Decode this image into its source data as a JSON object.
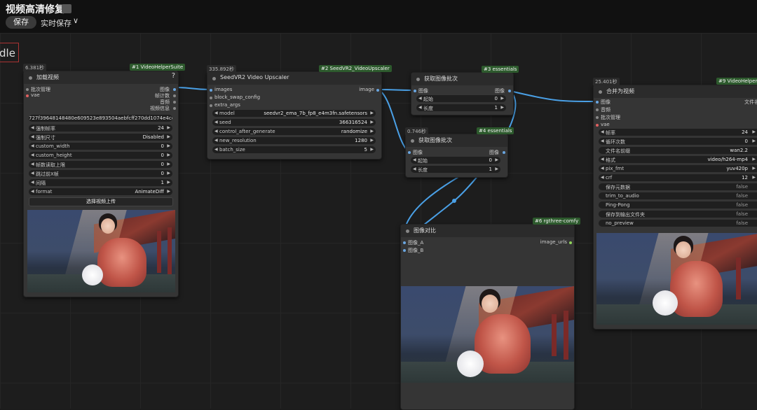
{
  "app": {
    "title": "视频高清修复",
    "save_label": "保存",
    "autosave_label": "实时保存",
    "autosave_chevron": "∨"
  },
  "group_label": "dle",
  "nodes": {
    "load_video": {
      "timer": "6.381秒",
      "badge": "#1 VideoHelperSuite",
      "title": "加载视频",
      "help": "?",
      "inputs": [
        "批次管理",
        "vae"
      ],
      "outputs": [
        "图像",
        "帧计数",
        "音频",
        "视频信息"
      ],
      "hash": "727f39648148480e609523e893504aebfcff270dd1074e4ce91a ...",
      "widgets": [
        {
          "label": "强制帧率",
          "value": "24"
        },
        {
          "label": "强制尺寸",
          "value": "Disabled"
        },
        {
          "label": "custom_width",
          "value": "0"
        },
        {
          "label": "custom_height",
          "value": "0"
        },
        {
          "label": "帧数读取上限",
          "value": "0"
        },
        {
          "label": "跳过前X帧",
          "value": "0"
        },
        {
          "label": "间隔",
          "value": "1"
        },
        {
          "label": "format",
          "value": "AnimateDiff"
        }
      ],
      "upload_label": "选择视频上传"
    },
    "upscaler": {
      "timer": "335.892秒",
      "badge": "#2 SeedVR2_VideoUpscaler",
      "title": "SeedVR2 Video Upscaler",
      "inputs": [
        "images",
        "block_swap_config",
        "extra_args"
      ],
      "output": "image",
      "widgets": [
        {
          "label": "model",
          "value": "seedvr2_ema_7b_fp8_e4m3fn.safetensors"
        },
        {
          "label": "seed",
          "value": "366316524"
        },
        {
          "label": "control_after_generate",
          "value": "randomize"
        },
        {
          "label": "new_resolution",
          "value": "1280"
        },
        {
          "label": "batch_size",
          "value": "5"
        }
      ]
    },
    "get_batch_3": {
      "badge": "#3 essentials",
      "title": "获取图像批次",
      "input": "图像",
      "output": "图像",
      "widgets": [
        {
          "label": "起始",
          "value": "0"
        },
        {
          "label": "长度",
          "value": "1"
        }
      ]
    },
    "get_batch_4": {
      "timer": "0.746秒",
      "badge": "#4 essentials",
      "title": "获取图像批次",
      "input": "图像",
      "output": "图像",
      "widgets": [
        {
          "label": "起始",
          "value": "0"
        },
        {
          "label": "长度",
          "value": "1"
        }
      ]
    },
    "compare": {
      "badge": "#6 rgthree-comfy",
      "title": "图像对比",
      "inputs": [
        "图像_A",
        "图像_B"
      ],
      "output": "image_urls"
    },
    "combine": {
      "timer": "25.401秒",
      "badge": "#9 VideoHelperSu",
      "title": "合并为视频",
      "inputs": [
        "图像",
        "音频",
        "批次管理",
        "vae"
      ],
      "output_partial": "文件名",
      "widgets": [
        {
          "label": "帧率",
          "value": "24"
        },
        {
          "label": "循环次数",
          "value": "0"
        },
        {
          "label": "文件名前缀",
          "value": "wan2.2"
        },
        {
          "label": "格式",
          "value": "video/h264-mp4"
        },
        {
          "label": "pix_fmt",
          "value": "yuv420p"
        },
        {
          "label": "crf",
          "value": "12"
        }
      ],
      "toggles": [
        {
          "label": "保存元数据",
          "value": "false"
        },
        {
          "label": "trim_to_audio",
          "value": "false"
        },
        {
          "label": "Ping-Pong",
          "value": "false"
        },
        {
          "label": "保存到输出文件夹",
          "value": "false"
        },
        {
          "label": "no_preview",
          "value": "false"
        }
      ]
    }
  },
  "colors": {
    "link": "#4aa0e6",
    "image_slot": "#6aa6e0",
    "vae_slot": "#e06060",
    "badge": "#2d5a2d"
  }
}
